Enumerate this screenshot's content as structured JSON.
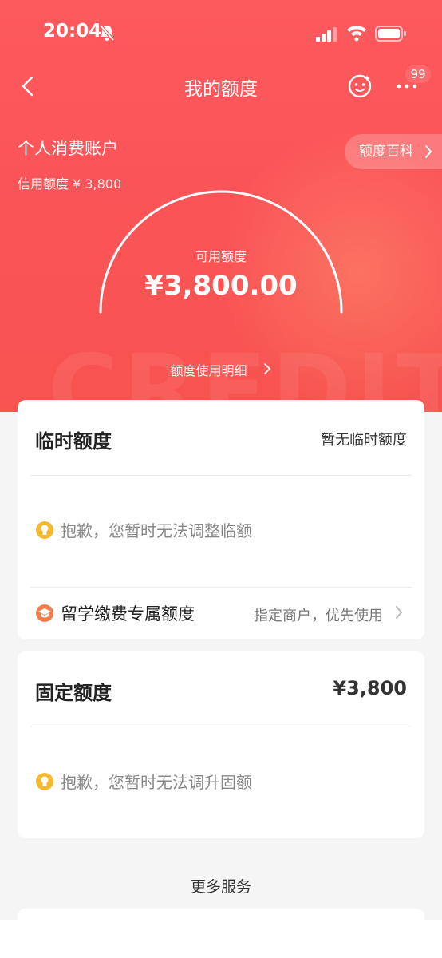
{
  "status_bar": {
    "time": "20:04"
  },
  "nav": {
    "title": "我的额度",
    "badge": "99"
  },
  "account": {
    "title": "个人消费账户",
    "credit_limit": "信用额度 ¥ 3,800",
    "wiki_label": "额度百科"
  },
  "gauge": {
    "label": "可用额度",
    "value": "¥3,800.00",
    "detail_link": "额度使用明细"
  },
  "watermark": "CREDIT",
  "temp_limit": {
    "title": "临时额度",
    "status": "暂无临时额度",
    "message": "抱歉，您暂时无法调整临额",
    "special_row": {
      "label": "留学缴费专属额度",
      "hint": "指定商户，优先使用"
    }
  },
  "fixed_limit": {
    "title": "固定额度",
    "amount": "¥3,800",
    "message": "抱歉，您暂时无法调升固额"
  },
  "more_services": "更多服务",
  "colors": {
    "brand_red": "#fb5458",
    "bulb_yellow": "#f5b82e",
    "cap_orange": "#f47b4a"
  }
}
